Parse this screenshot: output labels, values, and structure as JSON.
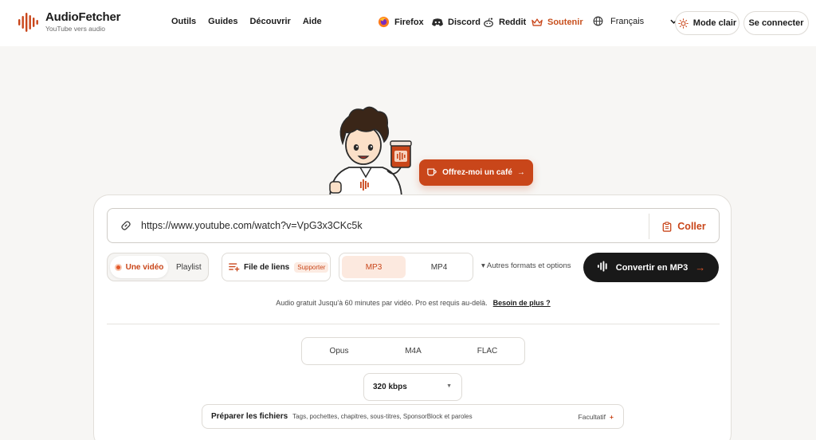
{
  "brand": {
    "name": "AudioFetcher",
    "tagline": "YouTube vers audio",
    "accent": "#c9461a"
  },
  "nav": {
    "items": [
      "Outils",
      "Guides",
      "Découvrir",
      "Aide"
    ]
  },
  "header_links": {
    "firefox": "Firefox",
    "discord": "Discord",
    "reddit": "Reddit",
    "support": "Soutenir"
  },
  "language": {
    "selected": "Français"
  },
  "theme_button": "Mode clair",
  "login_button": "Se connecter",
  "coffee_button": "Offrez-moi un café",
  "url_input": {
    "value": "https://www.youtube.com/watch?v=VpG3x3CKc5k"
  },
  "paste_button": "Coller",
  "mode": {
    "options": [
      "Une vidéo",
      "Playlist"
    ],
    "selected": "Une vidéo"
  },
  "link_file": {
    "label": "File de liens",
    "badge": "Supporter"
  },
  "format": {
    "options": [
      "MP3",
      "MP4"
    ],
    "selected": "MP3"
  },
  "more_options": "▾ Autres formats et options",
  "convert_button": "Convertir en MP3",
  "note": {
    "text": "Audio gratuit  Jusqu'à 60 minutes par vidéo. Pro est requis au-delà.",
    "link": "Besoin de plus ?"
  },
  "codecs": [
    "Opus",
    "M4A",
    "FLAC"
  ],
  "bitrate": {
    "selected": "320 kbps"
  },
  "prepare_files": {
    "title": "Préparer les fichiers",
    "description": "Tags, pochettes, chapitres, sous-titres, SponsorBlock et paroles",
    "optional": "Facultatif",
    "plus": "+"
  }
}
